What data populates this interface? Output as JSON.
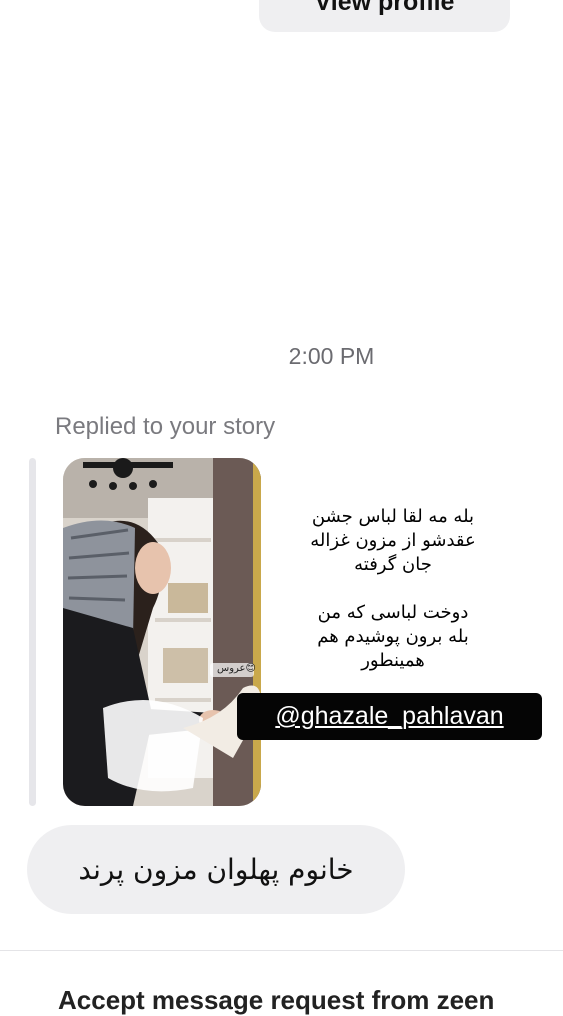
{
  "header": {
    "view_profile_label": "View profile"
  },
  "thread": {
    "timestamp": "2:00 PM",
    "replied_label": "Replied to your story",
    "story": {
      "text_line_1": "بله مه لقا لباس جشن",
      "text_line_2": "عقدشو از مزون غزاله",
      "text_line_3": "جان گرفته",
      "text_line_4": "دوخت لباسی که من",
      "text_line_5": "بله برون پوشیدم هم",
      "text_line_6": "همینطور",
      "sticker_text": "عروس😊",
      "mention": "@ghazale_pahlavan"
    },
    "message": "خانوم پهلوان مزون پرند"
  },
  "footer": {
    "accept_text": "Accept message request from zeen"
  },
  "colors": {
    "bubble": "#efeff1",
    "tag": "#050505",
    "muted": "#7a7a7f"
  }
}
